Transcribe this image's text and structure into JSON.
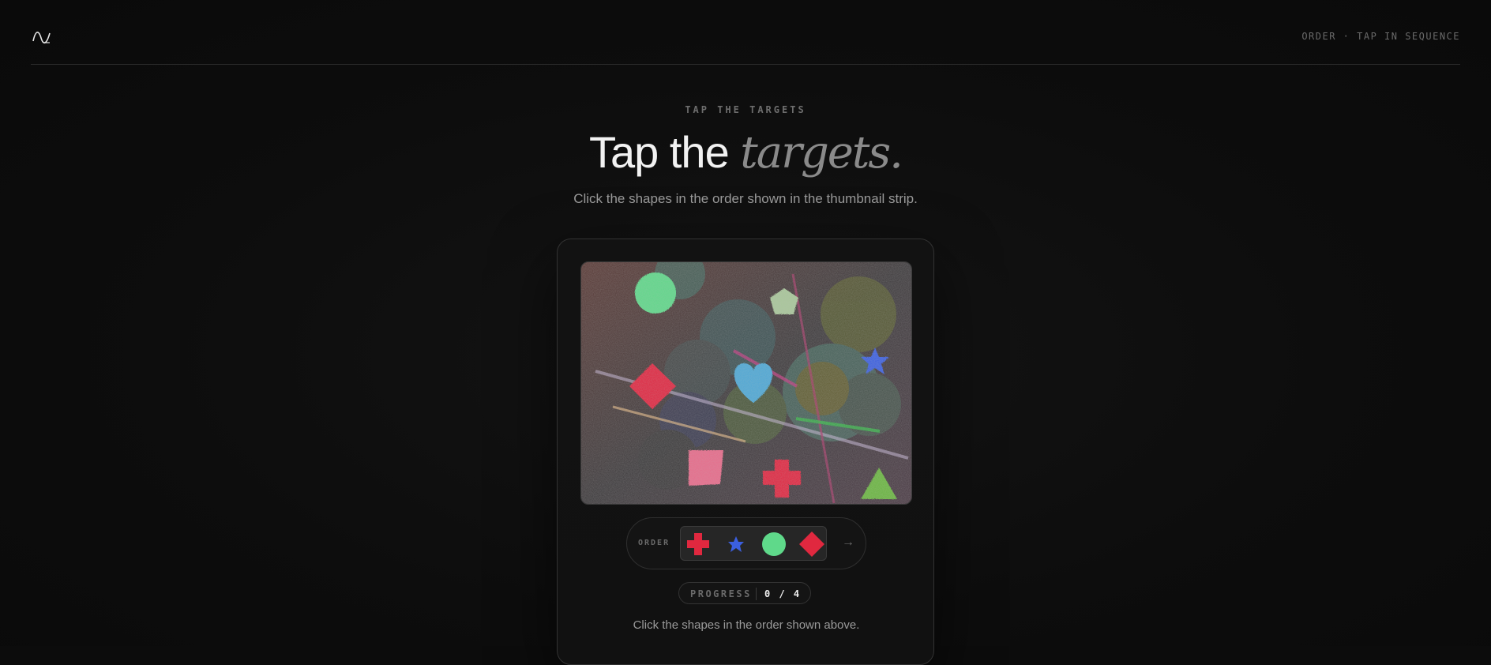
{
  "header": {
    "logo_icon": "wave-logo-icon",
    "mode_label": "ORDER · TAP IN SEQUENCE"
  },
  "hero": {
    "eyebrow": "TAP THE TARGETS",
    "title_main": "Tap the ",
    "title_accent": "targets.",
    "subtitle": "Click the shapes in the order shown in the thumbnail strip."
  },
  "game": {
    "targets": [
      {
        "name": "green-circle",
        "color": "#5fd98a"
      },
      {
        "name": "pale-green-pentagon",
        "color": "#a9c79a"
      },
      {
        "name": "blue-star",
        "color": "#3b5fe0"
      },
      {
        "name": "cyan-heart",
        "color": "#4ea8d6"
      },
      {
        "name": "red-diamond",
        "color": "#e0283f"
      },
      {
        "name": "pink-square",
        "color": "#e86a8a"
      },
      {
        "name": "red-cross",
        "color": "#e0283f"
      },
      {
        "name": "green-triangle",
        "color": "#6ab640"
      }
    ],
    "order_label": "ORDER",
    "order_sequence": [
      {
        "icon": "red-cross-icon",
        "color": "#e0283f"
      },
      {
        "icon": "blue-star-icon",
        "color": "#3b5fe0"
      },
      {
        "icon": "green-circle-icon",
        "color": "#5fd98a"
      },
      {
        "icon": "red-diamond-icon",
        "color": "#e0283f"
      }
    ],
    "arrow_icon": "arrow-right-icon",
    "arrow": "→",
    "progress_label": "PROGRESS",
    "progress_value": "0 / 4",
    "hint": "Click the shapes in the order shown above."
  }
}
